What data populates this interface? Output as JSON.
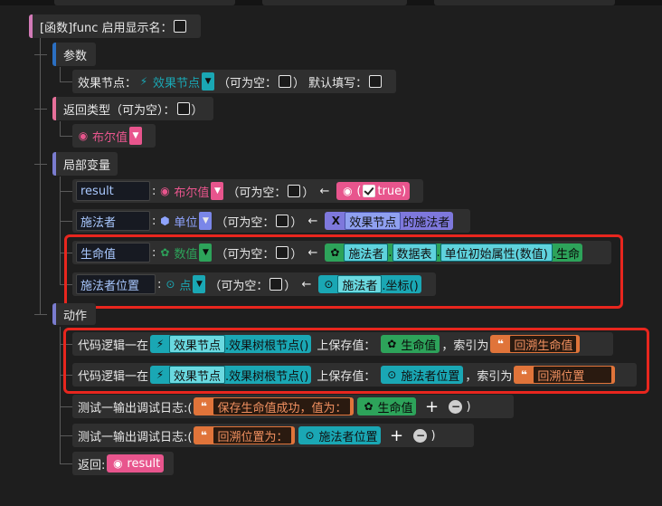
{
  "func": {
    "label": "[函数]func 启用显示名："
  },
  "params": {
    "label": "参数",
    "param_name": "效果节点：",
    "param_type": "效果节点",
    "nullable": "（可为空：",
    "nullable_close": "）",
    "default_fill": "默认填写："
  },
  "return_type": {
    "label": "返回类型（可为空）：",
    "close": "）",
    "value": "布尔值"
  },
  "locals": {
    "label": "局部变量",
    "rows": [
      {
        "name": "result",
        "type": "布尔值",
        "nullable": "（可为空：",
        "close": "）",
        "arrow": "←",
        "init_open": "(",
        "init_value": "true",
        "init_close": ")"
      },
      {
        "name": "施法者",
        "type": "单位",
        "nullable": "（可为空：",
        "close": "）",
        "arrow": "←",
        "init_node": "效果节点",
        "init_suffix": "的施法者"
      },
      {
        "name": "生命值",
        "type": "数值",
        "nullable": "（可为空：",
        "close": "）",
        "arrow": "←",
        "p1": "施法者",
        "p2": "数据表",
        "p3": "单位初始属性(数值)",
        "p4": ".生命"
      },
      {
        "name": "施法者位置",
        "type": "点",
        "nullable": "（可为空：",
        "close": "）",
        "arrow": "←",
        "p1": "施法者",
        "p2": ".坐标()"
      }
    ]
  },
  "actions": {
    "label": "动作",
    "rows": [
      {
        "prefix": "代码逻辑一在",
        "node": "效果节点",
        "method": ".效果树根节点()",
        "mid": "上保存值：",
        "value": "生命值",
        "mid2": "，索引为",
        "key": "回溯生命值"
      },
      {
        "prefix": "代码逻辑一在",
        "node": "效果节点",
        "method": ".效果树根节点()",
        "mid": "上保存值：",
        "value": "施法者位置",
        "mid2": "，索引为",
        "key": "回溯位置"
      },
      {
        "prefix": "测试一输出调试日志:(",
        "str": "保存生命值成功，值为：",
        "value": "生命值",
        "plus": "+",
        "minus": "−",
        "close": ")"
      },
      {
        "prefix": "测试一输出调试日志:(",
        "str": "回溯位置为：",
        "value": "施法者位置",
        "plus": "+",
        "minus": "−",
        "close": ")"
      },
      {
        "prefix": "返回:",
        "value": "result"
      }
    ]
  },
  "colors": {
    "highlight": "#e8261e",
    "teal": "#1aa7b4",
    "pink": "#e8558d",
    "green": "#2da35a",
    "orange": "#e0743a",
    "purple": "#7e78dc"
  }
}
